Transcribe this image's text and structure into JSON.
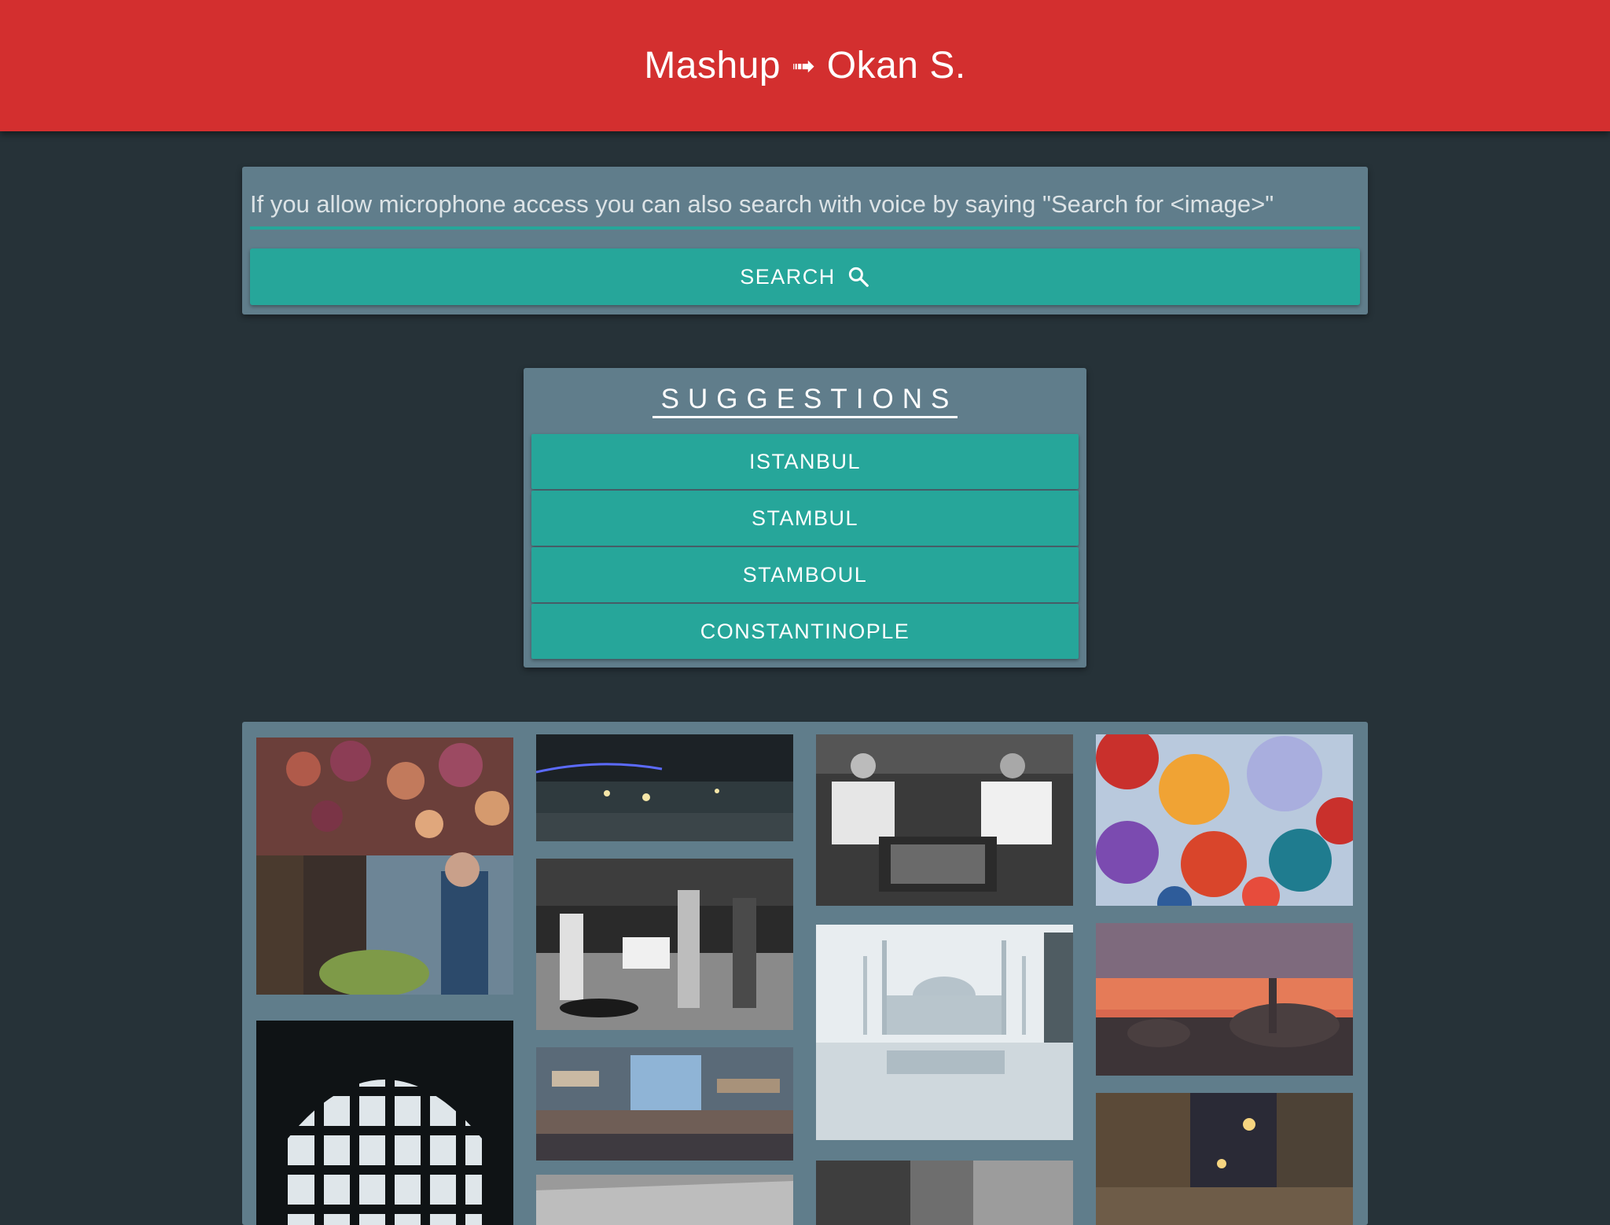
{
  "header": {
    "title_left": "Mashup",
    "arrow": "➟",
    "title_right": "Okan S."
  },
  "search": {
    "placeholder": "If you allow microphone access you can also search with voice by saying \"Search for <image>\"",
    "value": "",
    "button_label": "SEARCH",
    "button_icon": "search-icon"
  },
  "suggestions": {
    "title": "SUGGESTIONS",
    "items": [
      "ISTANBUL",
      "STAMBUL",
      "STAMBOUL",
      "CONSTANTINOPLE"
    ]
  },
  "gallery": {
    "photos": [
      {
        "subject": "spice market vendor under flower canopy"
      },
      {
        "subject": "domed window grille silhouette"
      },
      {
        "subject": "Bosphorus bridge at night"
      },
      {
        "subject": "waiters in street cafe black and white"
      },
      {
        "subject": "glitched bazaar street"
      },
      {
        "subject": "rooftops black and white"
      },
      {
        "subject": "men playing backgammon black and white"
      },
      {
        "subject": "Blue Mosque reflection in fog"
      },
      {
        "subject": "narrow street black and white"
      },
      {
        "subject": "colorful umbrellas overhead"
      },
      {
        "subject": "sunset over domes and minarets"
      },
      {
        "subject": "night street with crowds"
      }
    ]
  },
  "colors": {
    "app_bar": "#d32f2f",
    "background": "#263238",
    "card": "#607d8b",
    "accent": "#26a69a"
  }
}
